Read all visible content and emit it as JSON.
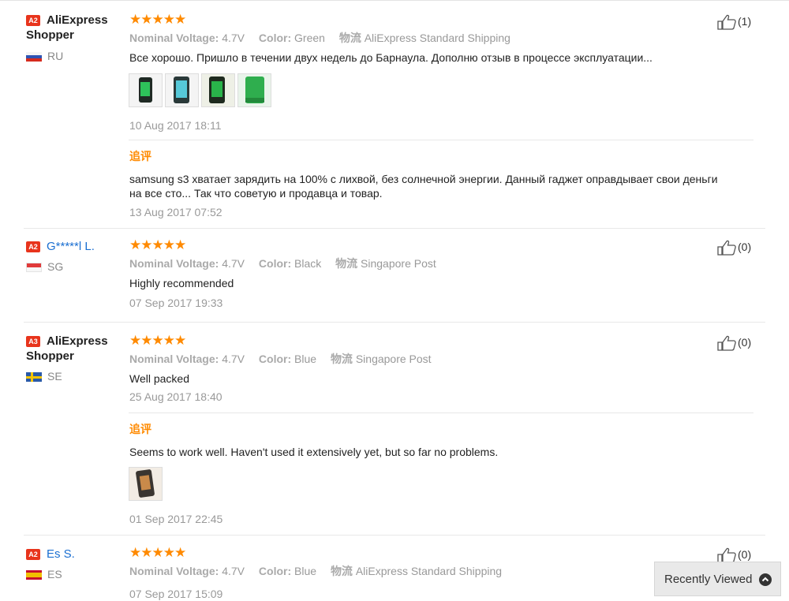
{
  "reviews": [
    {
      "badge": "A2",
      "badge_color": "#e8341c",
      "user": "AliExpress Shopper",
      "country": "RU",
      "stars": "★★★★★",
      "voltage_label": "Nominal Voltage:",
      "voltage": "4.7V",
      "color_label": "Color:",
      "color": "Green",
      "ship_label": "物流",
      "shipping": "AliExpress Standard Shipping",
      "text": "Все хорошо. Пришло в течении двух недель до Барнаула. Дополню отзыв в процессе эксплуатации...",
      "date": "10 Aug 2017 18:11",
      "likes": "(1)",
      "additional": {
        "tag": "追评",
        "text_line1": "samsung s3 хватает зарядить на 100% с лихвой, без солнечной энергии. Данный гаджет оправдывает свои деньги",
        "text_line2": "на все сто... Так что советую и продавца и товар.",
        "date": "13 Aug 2017 07:52"
      }
    },
    {
      "badge": "A2",
      "badge_color": "#e8341c",
      "user": "G*****l L.",
      "country": "SG",
      "stars": "★★★★★",
      "voltage_label": "Nominal Voltage:",
      "voltage": "4.7V",
      "color_label": "Color:",
      "color": "Black",
      "ship_label": "物流",
      "shipping": "Singapore Post",
      "text": "Highly recommended",
      "date": "07 Sep 2017 19:33",
      "likes": "(0)"
    },
    {
      "badge": "A3",
      "badge_color": "#e8341c",
      "user": "AliExpress Shopper",
      "country": "SE",
      "stars": "★★★★★",
      "voltage_label": "Nominal Voltage:",
      "voltage": "4.7V",
      "color_label": "Color:",
      "color": "Blue",
      "ship_label": "物流",
      "shipping": "Singapore Post",
      "text": "Well packed",
      "date": "25 Aug 2017 18:40",
      "likes": "(0)",
      "additional": {
        "tag": "追评",
        "text_line1": "Seems to work well. Haven't used it extensively yet, but so far no problems.",
        "date": "01 Sep 2017 22:45"
      }
    },
    {
      "badge": "A2",
      "badge_color": "#e8341c",
      "user": "Es S.",
      "country": "ES",
      "stars": "★★★★★",
      "voltage_label": "Nominal Voltage:",
      "voltage": "4.7V",
      "color_label": "Color:",
      "color": "Blue",
      "ship_label": "物流",
      "shipping": "AliExpress Standard Shipping",
      "date": "07 Sep 2017 15:09",
      "likes": "(0)"
    }
  ],
  "recently_viewed": {
    "label": "Recently Viewed",
    "icon": "chevron-up-icon"
  },
  "colors": {
    "star": "#ff8a00",
    "badge": "#e8341c",
    "link": "#1b6fd1"
  }
}
